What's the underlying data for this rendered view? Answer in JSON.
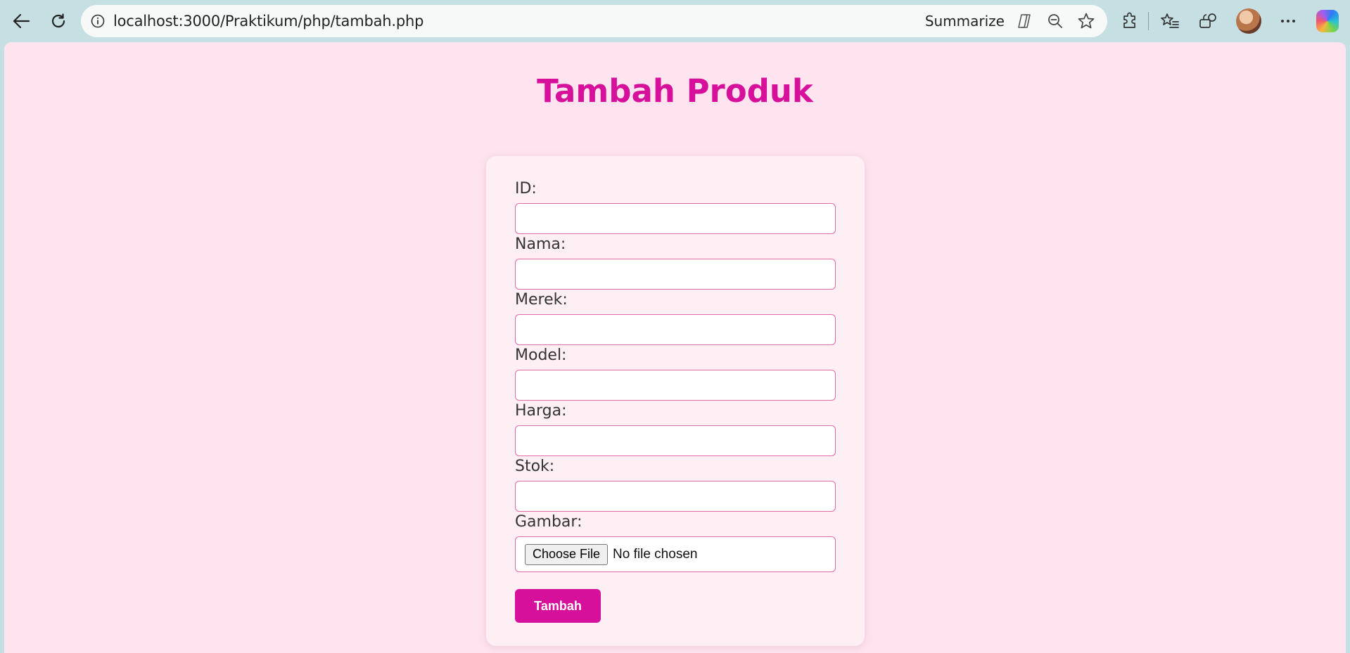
{
  "browser": {
    "url": "localhost:3000/Praktikum/php/tambah.php",
    "summarize_label": "Summarize"
  },
  "page": {
    "title": "Tambah Produk",
    "fields": [
      {
        "label": "ID:",
        "value": ""
      },
      {
        "label": "Nama:",
        "value": ""
      },
      {
        "label": "Merek:",
        "value": ""
      },
      {
        "label": "Model:",
        "value": ""
      },
      {
        "label": "Harga:",
        "value": ""
      },
      {
        "label": "Stok:",
        "value": ""
      }
    ],
    "file_field": {
      "label": "Gambar:",
      "button_label": "Choose File",
      "status": "No file chosen"
    },
    "submit_label": "Tambah"
  },
  "colors": {
    "accent": "#d6109a",
    "page_bg": "#fde4ef",
    "card_bg": "#fdeff4",
    "input_border": "#e06aa6",
    "chrome_bg": "#c6dfe3"
  }
}
